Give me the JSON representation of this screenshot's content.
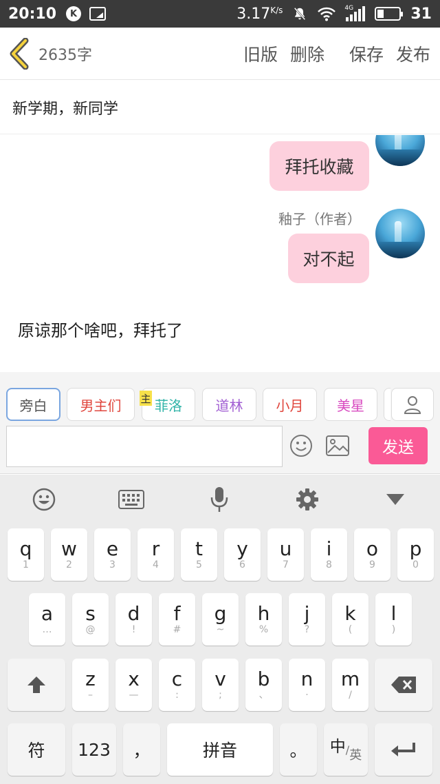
{
  "status": {
    "time": "20:10",
    "speed": "3.17",
    "speed_unit": "K/s",
    "net_label": "4G",
    "battery": "31"
  },
  "topbar": {
    "word_count": "2635字",
    "old_version": "旧版",
    "delete": "删除",
    "save": "保存",
    "publish": "发布"
  },
  "title": "新学期，新同学",
  "chat": {
    "bubble1": "拜托收藏",
    "author_name": "釉子（作者）",
    "bubble2": "对不起",
    "narration": "原谅那个啥吧，拜托了"
  },
  "characters": [
    {
      "label": "旁白",
      "color": "#555555"
    },
    {
      "label": "男主们",
      "color": "#e0463d"
    },
    {
      "label": "菲洛",
      "color": "#2fb3a7"
    },
    {
      "label": "道林",
      "color": "#a25fd3"
    },
    {
      "label": "小月",
      "color": "#e0463d"
    },
    {
      "label": "美星",
      "color": "#d84ac0"
    }
  ],
  "character_tag": "主",
  "composer": {
    "send": "发送"
  },
  "keyboard": {
    "row1": [
      {
        "k": "q",
        "s": "1"
      },
      {
        "k": "w",
        "s": "2"
      },
      {
        "k": "e",
        "s": "3"
      },
      {
        "k": "r",
        "s": "4"
      },
      {
        "k": "t",
        "s": "5"
      },
      {
        "k": "y",
        "s": "6"
      },
      {
        "k": "u",
        "s": "7"
      },
      {
        "k": "i",
        "s": "8"
      },
      {
        "k": "o",
        "s": "9"
      },
      {
        "k": "p",
        "s": "0"
      }
    ],
    "row2": [
      {
        "k": "a",
        "s": "…"
      },
      {
        "k": "s",
        "s": "@"
      },
      {
        "k": "d",
        "s": "!"
      },
      {
        "k": "f",
        "s": "#"
      },
      {
        "k": "g",
        "s": "~"
      },
      {
        "k": "h",
        "s": "%"
      },
      {
        "k": "j",
        "s": "?"
      },
      {
        "k": "k",
        "s": "("
      },
      {
        "k": "l",
        "s": ")"
      }
    ],
    "row3": [
      {
        "k": "z",
        "s": "–"
      },
      {
        "k": "x",
        "s": "—"
      },
      {
        "k": "c",
        "s": ":"
      },
      {
        "k": "v",
        "s": ";"
      },
      {
        "k": "b",
        "s": "、"
      },
      {
        "k": "n",
        "s": "·"
      },
      {
        "k": "m",
        "s": "/"
      }
    ],
    "symbol": "符",
    "numbers": "123",
    "comma": "，",
    "pinyin": "拼音",
    "period": "。",
    "lang_main": "中",
    "lang_sub": "英"
  },
  "accent_color": "#fa5a96",
  "bubble_color": "#fdd0dd"
}
